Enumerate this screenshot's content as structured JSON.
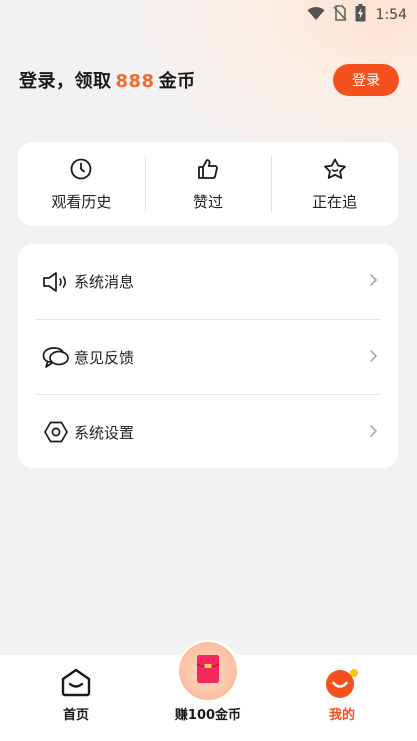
{
  "status_bar": {
    "time": "1:54",
    "icons": [
      "wifi-icon",
      "no-sim-icon",
      "battery-charging-icon"
    ]
  },
  "header": {
    "login_prompt_prefix": "登录，领取",
    "login_prompt_amount": "888",
    "login_prompt_suffix": "金币",
    "login_button": "登录",
    "accent_color": "#f4511e"
  },
  "quick_actions": [
    {
      "label": "观看历史",
      "icon": "clock-icon"
    },
    {
      "label": "赞过",
      "icon": "thumbs-up-icon"
    },
    {
      "label": "正在追",
      "icon": "star-icon"
    }
  ],
  "menu": [
    {
      "label": "系统消息",
      "icon": "speaker-icon"
    },
    {
      "label": "意见反馈",
      "icon": "chat-bubbles-icon"
    },
    {
      "label": "系统设置",
      "icon": "hexagon-settings-icon"
    }
  ],
  "bottom_nav": {
    "home": {
      "label": "首页",
      "icon": "home-icon"
    },
    "earn": {
      "label": "赚100金币",
      "icon": "red-envelope-icon"
    },
    "mine": {
      "label": "我的",
      "icon": "smiley-icon",
      "active": true
    }
  }
}
